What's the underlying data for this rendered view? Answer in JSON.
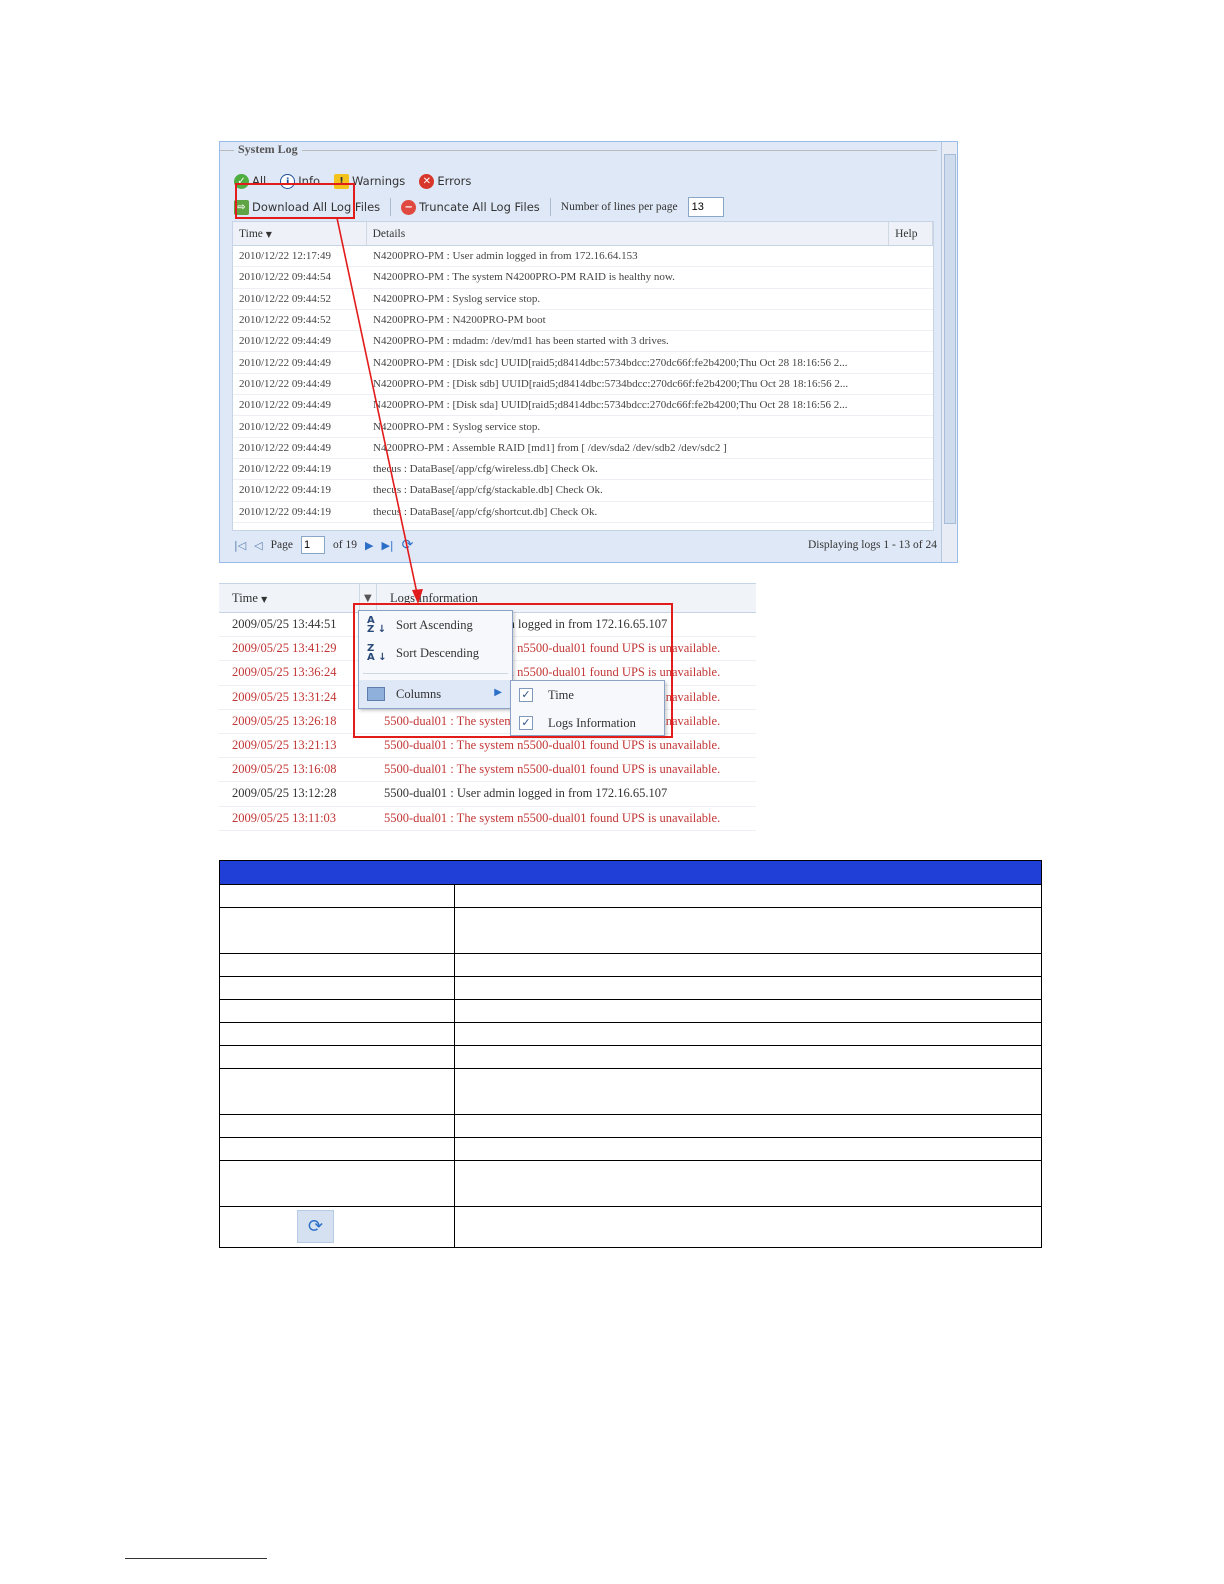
{
  "system_log": {
    "title": "System Log",
    "filters": {
      "all": "All",
      "info": "Info",
      "warnings": "Warnings",
      "errors": "Errors"
    },
    "toolbar": {
      "download": "Download All Log Files",
      "truncate": "Truncate All Log Files",
      "lines_label": "Number of lines per page",
      "lines_value": "13"
    },
    "columns": {
      "time": "Time",
      "details": "Details",
      "help": "Help"
    },
    "rows": [
      [
        "2010/12/22 12:17:49",
        "N4200PRO-PM : User admin logged in from 172.16.64.153"
      ],
      [
        "2010/12/22 09:44:54",
        "N4200PRO-PM : The system N4200PRO-PM RAID is healthy now."
      ],
      [
        "2010/12/22 09:44:52",
        "N4200PRO-PM : Syslog service stop."
      ],
      [
        "2010/12/22 09:44:52",
        "N4200PRO-PM : N4200PRO-PM boot"
      ],
      [
        "2010/12/22 09:44:49",
        "N4200PRO-PM : mdadm: /dev/md1 has been started with 3 drives."
      ],
      [
        "2010/12/22 09:44:49",
        "N4200PRO-PM : [Disk sdc] UUID[raid5;d8414dbc:5734bdcc:270dc66f:fe2b4200;Thu Oct 28 18:16:56 2..."
      ],
      [
        "2010/12/22 09:44:49",
        "N4200PRO-PM : [Disk sdb] UUID[raid5;d8414dbc:5734bdcc:270dc66f:fe2b4200;Thu Oct 28 18:16:56 2..."
      ],
      [
        "2010/12/22 09:44:49",
        "N4200PRO-PM : [Disk sda] UUID[raid5;d8414dbc:5734bdcc:270dc66f:fe2b4200;Thu Oct 28 18:16:56 2..."
      ],
      [
        "2010/12/22 09:44:49",
        "N4200PRO-PM : Syslog service stop."
      ],
      [
        "2010/12/22 09:44:49",
        "N4200PRO-PM : Assemble RAID [md1] from [ /dev/sda2 /dev/sdb2 /dev/sdc2 ]"
      ],
      [
        "2010/12/22 09:44:19",
        "thecus : DataBase[/app/cfg/wireless.db] Check Ok."
      ],
      [
        "2010/12/22 09:44:19",
        "thecus : DataBase[/app/cfg/stackable.db] Check Ok."
      ],
      [
        "2010/12/22 09:44:19",
        "thecus : DataBase[/app/cfg/shortcut.db] Check Ok."
      ]
    ],
    "pager": {
      "page_label": "Page",
      "page_value": "1",
      "of_label": "of 19",
      "displaying": "Displaying logs 1 - 13 of 24"
    }
  },
  "logs_grid": {
    "columns": {
      "time": "Time",
      "info": "Logs Information"
    },
    "rows": [
      {
        "time": "2009/05/25 13:44:51",
        "msg": "5500-dual01 : User admin logged in from 172.16.65.107",
        "level": "info"
      },
      {
        "time": "2009/05/25 13:41:29",
        "msg": "5500-dual01 : The system n5500-dual01 found UPS is unavailable.",
        "level": "error"
      },
      {
        "time": "2009/05/25 13:36:24",
        "msg": "5500-dual01 : The system n5500-dual01 found UPS is unavailable.",
        "level": "error"
      },
      {
        "time": "2009/05/25 13:31:24",
        "msg": "5500-dual01 : The system n5500-dual01 found UPS is unavailable.",
        "level": "error"
      },
      {
        "time": "2009/05/25 13:26:18",
        "msg": "5500-dual01 : The system n5500-dual01 found UPS is unavailable.",
        "level": "error"
      },
      {
        "time": "2009/05/25 13:21:13",
        "msg": "5500-dual01 : The system n5500-dual01 found UPS is unavailable.",
        "level": "error"
      },
      {
        "time": "2009/05/25 13:16:08",
        "msg": "5500-dual01 : The system n5500-dual01 found UPS is unavailable.",
        "level": "error"
      },
      {
        "time": "2009/05/25 13:12:28",
        "msg": "5500-dual01 : User admin logged in from 172.16.65.107",
        "level": "info"
      },
      {
        "time": "2009/05/25 13:11:03",
        "msg": "5500-dual01 : The system n5500-dual01 found UPS is unavailable.",
        "level": "error"
      }
    ],
    "menu": {
      "sort_asc": "Sort Ascending",
      "sort_desc": "Sort Descending",
      "columns": "Columns",
      "col_time": "Time",
      "col_info": "Logs Information"
    }
  },
  "colors": {
    "table_header": "#1f3fd6",
    "error_text": "#c23535",
    "highlight": "#e21b1b"
  }
}
